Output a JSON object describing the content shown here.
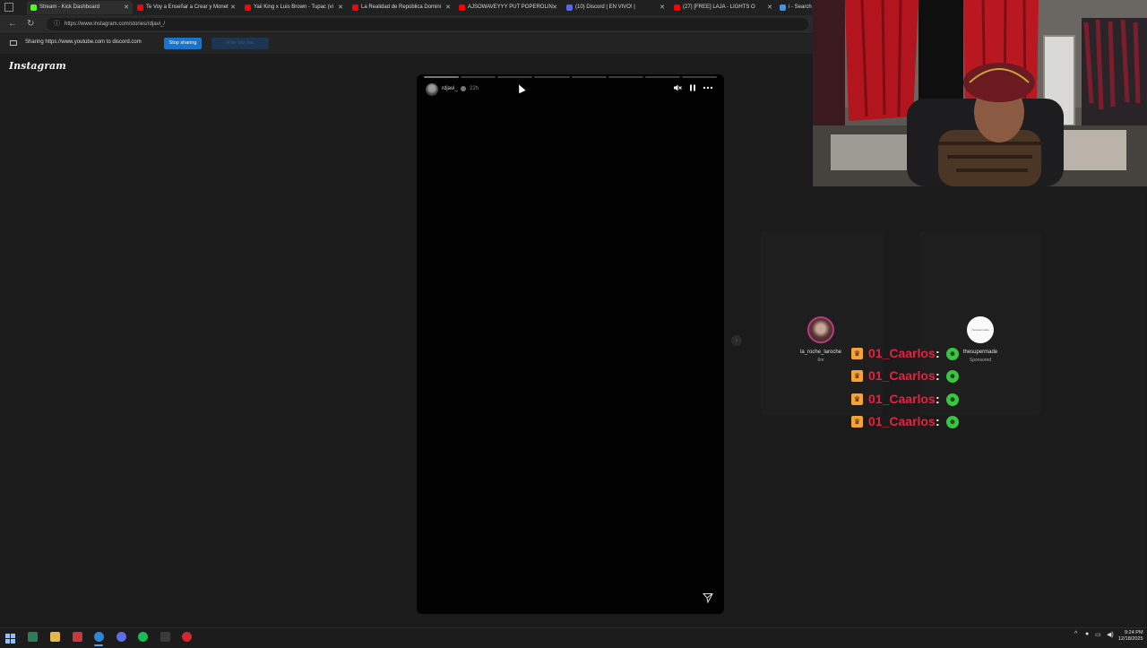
{
  "browser": {
    "tabs": [
      {
        "label": "Stream - Kick Dashboard",
        "favicon_color": "#53fc18",
        "active": true
      },
      {
        "label": "Te Voy a Enseñar a Crear y Monet",
        "favicon_color": "#ff0000"
      },
      {
        "label": "Yaii King x Luis Brown - Tupac (vi",
        "favicon_color": "#ff0000"
      },
      {
        "label": "La Realidad de República Domini",
        "favicon_color": "#ff0000"
      },
      {
        "label": "AJSOWAVEYYY PUT POPEROLIN",
        "favicon_color": "#ff0000"
      },
      {
        "label": "(10) Discord | EN VIVO! |",
        "favicon_color": "#5865f2"
      },
      {
        "label": "(27) [FREE] LAJA - LIGHTS O",
        "favicon_color": "#ff0000"
      },
      {
        "label": "i - Search",
        "favicon_color": "#4a90e2"
      }
    ],
    "url": "https://www.instagram.com/stories/rdjavi_/"
  },
  "sharebar": {
    "text": "Sharing https://www.youtube.com to discord.com",
    "stop_label": "Stop sharing",
    "hide_label": "Hide this bar"
  },
  "instagram": {
    "logo": "Instagram",
    "story": {
      "username": "rdjavi_",
      "time": "22h",
      "segments_total": 8,
      "segments_done": 1,
      "mute_icon": "speaker-muted-icon",
      "pause_icon": "pause-icon",
      "more_icon": "more-options-icon",
      "send_icon": "send-icon"
    },
    "next_arrow": "›",
    "side_stories": [
      {
        "name": "la_roche_laroche",
        "sub": "6m"
      },
      {
        "name": "thesupermade",
        "sub": "Sponsored",
        "avatar_text": "thesupermade"
      }
    ]
  },
  "chat": {
    "messages": [
      {
        "user": "01_Caarlos",
        "badge": "crown",
        "user_color": "#e8203f"
      },
      {
        "user": "01_Caarlos",
        "badge": "crown",
        "user_color": "#e8203f"
      },
      {
        "user": "01_Caarlos",
        "badge": "crown",
        "user_color": "#e8203f"
      },
      {
        "user": "01_Caarlos",
        "badge": "crown",
        "user_color": "#e8203f"
      }
    ]
  },
  "taskbar": {
    "time": "9:24 PM",
    "date": "12/18/2025"
  }
}
